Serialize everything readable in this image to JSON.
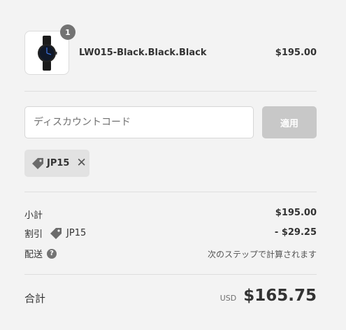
{
  "product": {
    "quantity": "1",
    "name": "LW015-Black.Black.Black",
    "price": "$195.00",
    "image_icon": "watch-icon"
  },
  "discount": {
    "placeholder": "ディスカウントコード",
    "apply_label": "適用",
    "applied_code": "JP15"
  },
  "summary": {
    "subtotal_label": "小計",
    "subtotal_value": "$195.00",
    "discount_label": "割引",
    "discount_code": "JP15",
    "discount_value": "- $29.25",
    "shipping_label": "配送",
    "shipping_value": "次のステップで計算されます",
    "info_glyph": "?"
  },
  "total": {
    "label": "合計",
    "currency": "USD",
    "amount": "$165.75"
  },
  "colors": {
    "background": "#f3f3f3",
    "badge": "#737373",
    "apply_button": "#c8c8c8",
    "chip": "#e2e2e2"
  }
}
